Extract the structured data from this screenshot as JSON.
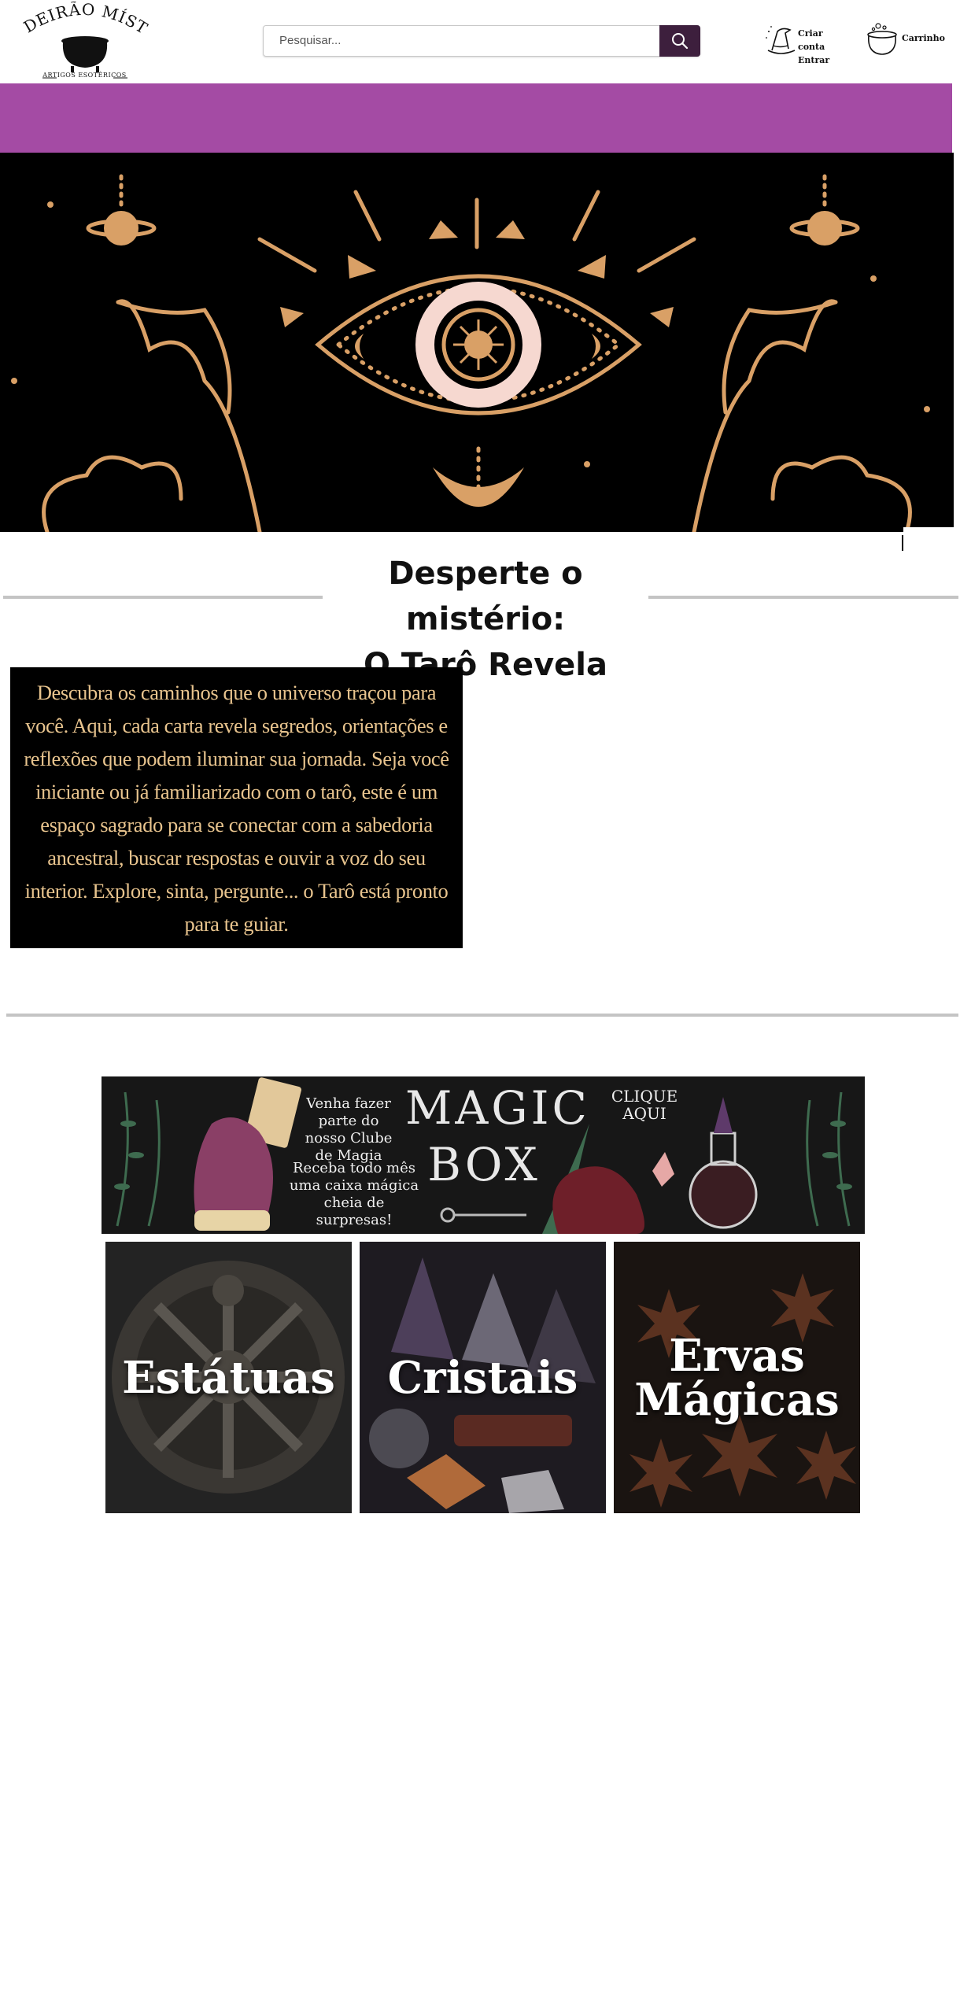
{
  "header": {
    "logo": {
      "brand": "CALDEIRÃO MÍSTICO",
      "tagline": "ARTIGOS ESOTÉRICOS"
    },
    "search": {
      "placeholder": "Pesquisar..."
    },
    "account": {
      "create_label": "Criar conta",
      "login_label": "Entrar"
    },
    "cart": {
      "label": "Carrinho"
    }
  },
  "section": {
    "title_line1": "Desperte o mistério:",
    "title_line2": "O Tarô Revela",
    "body": "Descubra os caminhos que o universo traçou para você. Aqui, cada carta revela segredos, orientações e reflexões que podem iluminar sua jornada. Seja você iniciante ou já familiarizado com o tarô, este é um espaço sagrado para se conectar com a sabedoria ancestral, buscar respostas e ouvir a voz do seu interior. Explore, sinta, pergunte... o Tarô está pronto para te guiar."
  },
  "magic_box": {
    "invite": "Venha fazer parte do nosso Clube de Magia",
    "offer": "Receba todo mês uma caixa mágica cheia de surpresas!",
    "title_1": "MAGIC",
    "title_2": "BOX",
    "cta": "CLIQUE AQUI"
  },
  "categories": [
    {
      "label": "Estátuas"
    },
    {
      "label": "Cristais"
    },
    {
      "label_1": "Ervas",
      "label_2": "Mágicas"
    }
  ],
  "colors": {
    "accent_purple": "#a44ba4",
    "search_button": "#3d1f3d",
    "hero_gold": "#d9a066",
    "hero_pink": "#f6d8d0",
    "text_card_gold": "#e8c48e"
  }
}
